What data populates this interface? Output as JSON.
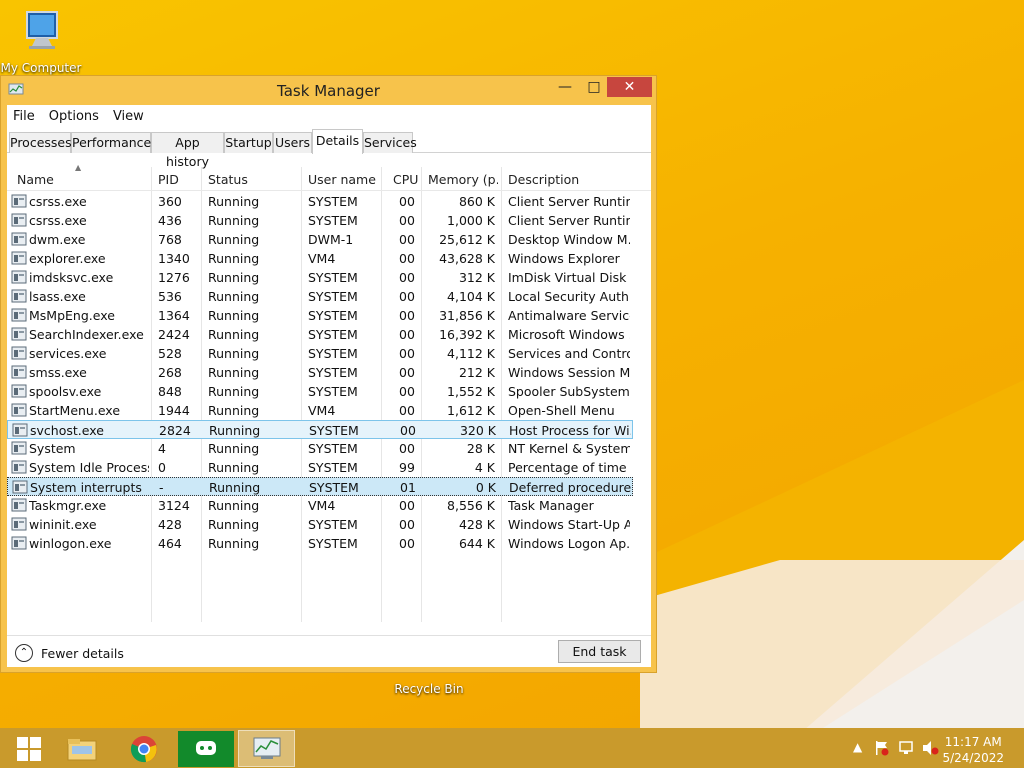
{
  "desktop": {
    "icons": [
      {
        "label": "My Computer"
      },
      {
        "label": "Recycle Bin"
      }
    ]
  },
  "window": {
    "title": "Task Manager",
    "menu": [
      "File",
      "Options",
      "View"
    ],
    "tabs": [
      "Processes",
      "Performance",
      "App history",
      "Startup",
      "Users",
      "Details",
      "Services"
    ],
    "active_tab": "Details",
    "columns": [
      "Name",
      "PID",
      "Status",
      "User name",
      "CPU",
      "Memory (p...",
      "Description"
    ],
    "rows": [
      {
        "name": "csrss.exe",
        "pid": "360",
        "status": "Running",
        "user": "SYSTEM",
        "cpu": "00",
        "mem": "860 K",
        "desc": "Client Server Runtim..."
      },
      {
        "name": "csrss.exe",
        "pid": "436",
        "status": "Running",
        "user": "SYSTEM",
        "cpu": "00",
        "mem": "1,000 K",
        "desc": "Client Server Runtim..."
      },
      {
        "name": "dwm.exe",
        "pid": "768",
        "status": "Running",
        "user": "DWM-1",
        "cpu": "00",
        "mem": "25,612 K",
        "desc": "Desktop Window M..."
      },
      {
        "name": "explorer.exe",
        "pid": "1340",
        "status": "Running",
        "user": "VM4",
        "cpu": "00",
        "mem": "43,628 K",
        "desc": "Windows Explorer"
      },
      {
        "name": "imdsksvc.exe",
        "pid": "1276",
        "status": "Running",
        "user": "SYSTEM",
        "cpu": "00",
        "mem": "312 K",
        "desc": "ImDisk Virtual Disk ..."
      },
      {
        "name": "lsass.exe",
        "pid": "536",
        "status": "Running",
        "user": "SYSTEM",
        "cpu": "00",
        "mem": "4,104 K",
        "desc": "Local Security Auth..."
      },
      {
        "name": "MsMpEng.exe",
        "pid": "1364",
        "status": "Running",
        "user": "SYSTEM",
        "cpu": "00",
        "mem": "31,856 K",
        "desc": "Antimalware Service..."
      },
      {
        "name": "SearchIndexer.exe",
        "pid": "2424",
        "status": "Running",
        "user": "SYSTEM",
        "cpu": "00",
        "mem": "16,392 K",
        "desc": "Microsoft Windows ..."
      },
      {
        "name": "services.exe",
        "pid": "528",
        "status": "Running",
        "user": "SYSTEM",
        "cpu": "00",
        "mem": "4,112 K",
        "desc": "Services and Control..."
      },
      {
        "name": "smss.exe",
        "pid": "268",
        "status": "Running",
        "user": "SYSTEM",
        "cpu": "00",
        "mem": "212 K",
        "desc": "Windows Session M..."
      },
      {
        "name": "spoolsv.exe",
        "pid": "848",
        "status": "Running",
        "user": "SYSTEM",
        "cpu": "00",
        "mem": "1,552 K",
        "desc": "Spooler SubSystem ..."
      },
      {
        "name": "StartMenu.exe",
        "pid": "1944",
        "status": "Running",
        "user": "VM4",
        "cpu": "00",
        "mem": "1,612 K",
        "desc": "Open-Shell Menu"
      },
      {
        "name": "svchost.exe",
        "pid": "2824",
        "status": "Running",
        "user": "SYSTEM",
        "cpu": "00",
        "mem": "320 K",
        "desc": "Host Process for Wi..."
      },
      {
        "name": "System",
        "pid": "4",
        "status": "Running",
        "user": "SYSTEM",
        "cpu": "00",
        "mem": "28 K",
        "desc": "NT Kernel & System"
      },
      {
        "name": "System Idle Process",
        "pid": "0",
        "status": "Running",
        "user": "SYSTEM",
        "cpu": "99",
        "mem": "4 K",
        "desc": "Percentage of time t..."
      },
      {
        "name": "System interrupts",
        "pid": "-",
        "status": "Running",
        "user": "SYSTEM",
        "cpu": "01",
        "mem": "0 K",
        "desc": "Deferred procedure ..."
      },
      {
        "name": "Taskmgr.exe",
        "pid": "3124",
        "status": "Running",
        "user": "VM4",
        "cpu": "00",
        "mem": "8,556 K",
        "desc": "Task Manager"
      },
      {
        "name": "wininit.exe",
        "pid": "428",
        "status": "Running",
        "user": "SYSTEM",
        "cpu": "00",
        "mem": "428 K",
        "desc": "Windows Start-Up A..."
      },
      {
        "name": "winlogon.exe",
        "pid": "464",
        "status": "Running",
        "user": "SYSTEM",
        "cpu": "00",
        "mem": "644 K",
        "desc": "Windows Logon Ap..."
      }
    ],
    "fewer_details_label": "Fewer details",
    "end_task_label": "End task"
  },
  "taskbar": {
    "time": "11:17 AM",
    "date": "5/24/2022"
  }
}
